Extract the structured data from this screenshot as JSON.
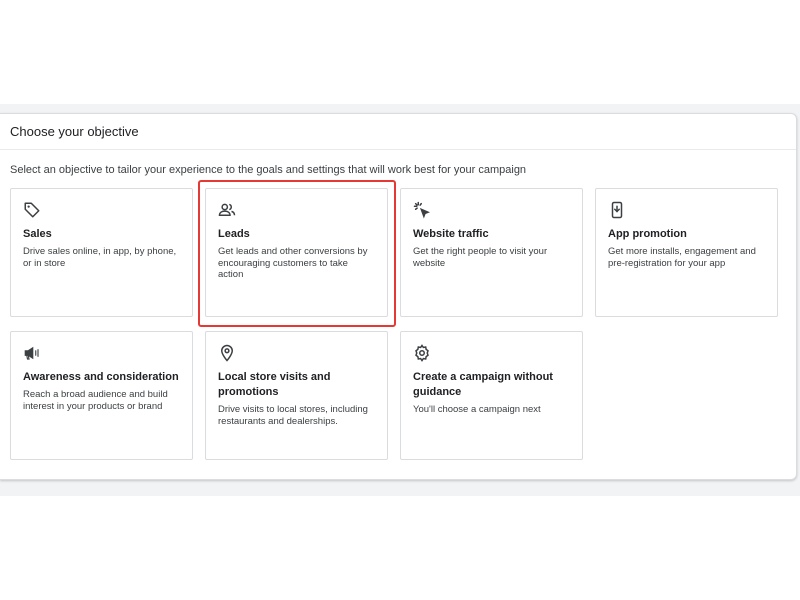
{
  "dialog": {
    "title": "Choose your objective",
    "subtitle": "Select an objective to tailor your experience to the goals and settings that will work best for your campaign"
  },
  "objectives": [
    {
      "title": "Sales",
      "description": "Drive sales online, in app, by phone, or in store",
      "icon": "tag-icon"
    },
    {
      "title": "Leads",
      "description": "Get leads and other conversions by encouraging customers to take action",
      "icon": "people-icon",
      "highlighted": true
    },
    {
      "title": "Website traffic",
      "description": "Get the right people to visit your website",
      "icon": "cursor-click-icon"
    },
    {
      "title": "App promotion",
      "description": "Get more installs, engagement and pre-registration for your app",
      "icon": "phone-download-icon"
    },
    {
      "title": "Awareness and consideration",
      "description": "Reach a broad audience and build interest in your products or brand",
      "icon": "megaphone-icon"
    },
    {
      "title": "Local store visits and promotions",
      "description": "Drive visits to local stores, including restaurants and dealerships.",
      "icon": "location-pin-icon"
    },
    {
      "title": "Create a campaign without guidance",
      "description": "You'll choose a campaign next",
      "icon": "gear-icon"
    }
  ],
  "colors": {
    "highlight_border": "#e53935",
    "card_border": "#dadce0",
    "backdrop": "#f1f3f4"
  }
}
